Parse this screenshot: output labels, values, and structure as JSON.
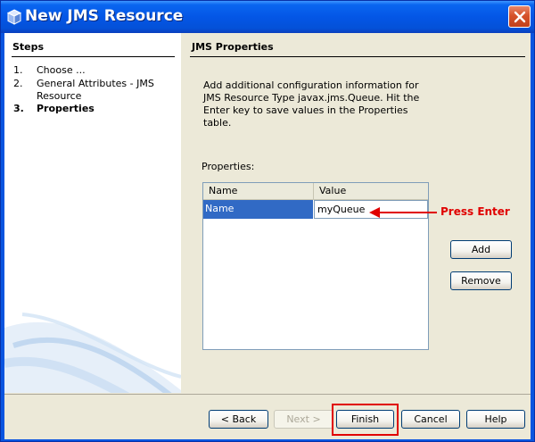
{
  "window": {
    "title": "New JMS Resource",
    "close_icon": "close-icon",
    "app_icon": "cube-icon"
  },
  "steps": {
    "title": "Steps",
    "items": [
      {
        "num": "1.",
        "label": "Choose ...",
        "active": false
      },
      {
        "num": "2.",
        "label": "General Attributes - JMS Resource",
        "active": false
      },
      {
        "num": "3.",
        "label": "Properties",
        "active": true
      }
    ]
  },
  "main": {
    "title": "JMS Properties",
    "description": "Add additional configuration information for JMS Resource Type javax.jms.Queue. Hit the Enter key to save values in the Properties table.",
    "properties_label": "Properties:",
    "table": {
      "columns": [
        "Name",
        "Value"
      ],
      "rows": [
        {
          "name": "Name",
          "value": "myQueue"
        }
      ]
    },
    "add_label": "Add",
    "remove_label": "Remove"
  },
  "annotation": {
    "text": "Press Enter",
    "color": "#e00000"
  },
  "footer": {
    "back_label": "< Back",
    "next_label": "Next >",
    "finish_label": "Finish",
    "cancel_label": "Cancel",
    "help_label": "Help"
  },
  "colors": {
    "title_bar": "#0456e6",
    "selection": "#316ac5",
    "dialog_bg": "#ece9d8",
    "highlight": "#e00000"
  }
}
